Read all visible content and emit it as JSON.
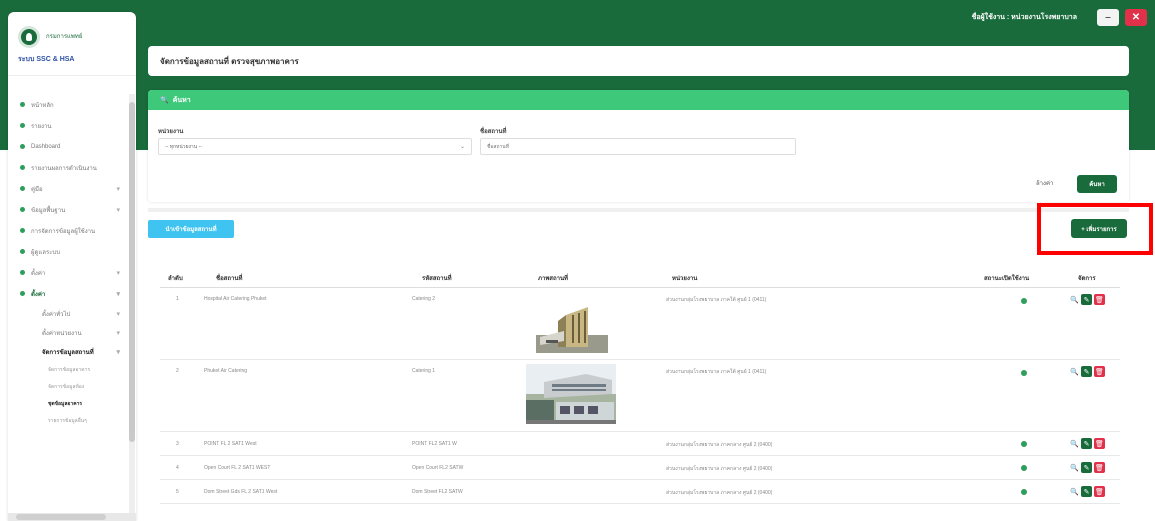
{
  "topbar": {
    "user_text": "ชื่อผู้ใช้งาน : หน่วยงานโรงพยาบาล",
    "minimize_symbol": "–",
    "close_symbol": "✕"
  },
  "sidebar": {
    "logo_name": "กรมการแพทย์",
    "system_name": "ระบบ SSC & HSA",
    "items": [
      {
        "label": "หน้าหลัก"
      },
      {
        "label": "รายงาน"
      },
      {
        "label": "Dashboard"
      },
      {
        "label": "รายงานผลการดำเนินงาน"
      },
      {
        "label": "คู่มือ",
        "chev": "▾"
      },
      {
        "label": "ข้อมูลพื้นฐาน",
        "chev": "▾"
      },
      {
        "label": "การจัดการข้อมูลผู้ใช้งาน"
      },
      {
        "label": "ผู้ดูแลระบบ"
      },
      {
        "label": "ตั้งค่า",
        "chev": "▾"
      },
      {
        "label": "ตั้งค่า",
        "chev": "▾"
      }
    ],
    "subitems": [
      {
        "label": "ตั้งค่าทั่วไป",
        "chev": "▾"
      },
      {
        "label": "ตั้งค่าหน่วยงาน",
        "chev": "▾"
      },
      {
        "label": "จัดการข้อมูลสถานที่",
        "chev": "▾"
      }
    ],
    "subsubitems": [
      {
        "label": "จัดการข้อมูลอาคาร"
      },
      {
        "label": "จัดการข้อมูลห้อง"
      },
      {
        "label": "ชุดข้อมูลอาคาร"
      },
      {
        "label": "รายการข้อมูลอื่นๆ"
      }
    ]
  },
  "page": {
    "title": "จัดการข้อมูลสถานที่ ตรวจสุขภาพอาคาร"
  },
  "search": {
    "header": "ค้นหา",
    "icon": "🔍",
    "select_label": "หน่วยงาน",
    "select_value": "-- ทุกหน่วยงาน --",
    "select_caret": "⌄",
    "input_label": "ชื่อสถานที่",
    "input_placeholder": "ชื่อสถานที่",
    "clear_label": "ล้างค่า",
    "search_label": "ค้นหา"
  },
  "actions": {
    "import_label": "นำเข้าข้อมูลสถานที่",
    "add_label": "+ เพิ่มรายการ"
  },
  "table": {
    "headers": [
      "ลำดับ",
      "ชื่อสถานที่",
      "รหัสสถานที่",
      "ภาพสถานที่",
      "หน่วยงาน",
      "สถานะเปิดใช้งาน",
      "จัดการ"
    ],
    "rows": [
      {
        "no": "1",
        "name": "Hospital Air Catering Phuket",
        "code": "Catering 2",
        "agency": "ส่วนงานกลุ่มโรงพยาบาล ภาคใต้ ศูนย์ 1 (0411)"
      },
      {
        "no": "2",
        "name": "Phuket Air Catering",
        "code": "Catering 1",
        "agency": "ส่วนงานกลุ่มโรงพยาบาล ภาคใต้ ศูนย์ 1 (0411)"
      },
      {
        "no": "3",
        "name": "POINT FL 2 SAT1 West",
        "code": "POINT FL2 SAT1 W",
        "agency": "ส่วนงานกลุ่มโรงพยาบาล ภาคกลาง ศูนย์ 2 (0400)"
      },
      {
        "no": "4",
        "name": "Open Court FL 2 SAT1 WEST",
        "code": "Open Court FL2 SATW",
        "agency": "ส่วนงานกลุ่มโรงพยาบาล ภาคกลาง ศูนย์ 2 (0400)"
      },
      {
        "no": "5",
        "name": "Dom Street Gds FL 2 SAT1 West",
        "code": "Dom Street FL2 SATW",
        "agency": "ส่วนงานกลุ่มโรงพยาบาล ภาคกลาง ศูนย์ 2 (0400)"
      }
    ],
    "view_icon": "🔍",
    "edit_icon": "✎",
    "delete_icon": "🗑"
  },
  "colors": {
    "brand_green": "#1a6b3c",
    "search_header_green": "#3ec97a",
    "import_blue": "#3fc3f0",
    "delete_red": "#e0304a",
    "highlight_red": "#ff0000"
  }
}
